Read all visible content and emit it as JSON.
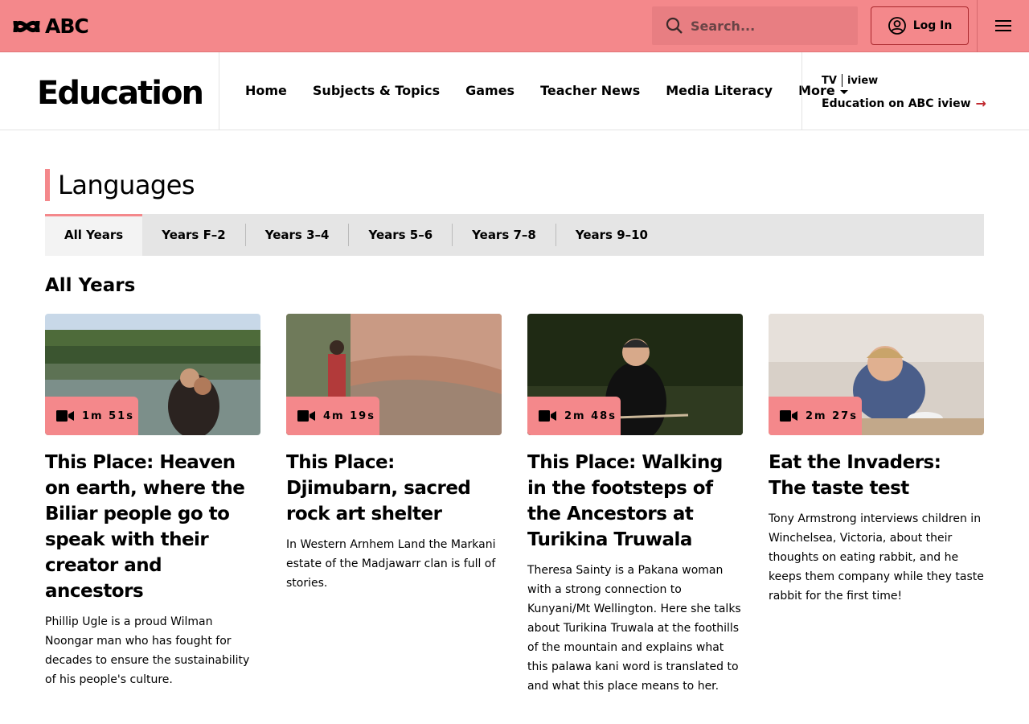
{
  "header": {
    "logo_text": "ABC",
    "search_placeholder": "Search...",
    "login_label": "Log In"
  },
  "section_nav": {
    "title": "Education",
    "links": [
      "Home",
      "Subjects & Topics",
      "Games",
      "Teacher News",
      "Media Literacy",
      "More"
    ],
    "iview": {
      "logo_tv": "TV",
      "logo_iview": "iview",
      "link_label": "Education on ABC iview"
    }
  },
  "page": {
    "heading": "Languages",
    "tabs": [
      "All Years",
      "Years F–2",
      "Years 3–4",
      "Years 5–6",
      "Years 7–8",
      "Years 9–10"
    ],
    "active_tab": "All Years",
    "subheading": "All Years"
  },
  "cards": [
    {
      "duration": "1m 51s",
      "title": "This Place: Heaven on earth, where the Biliar people go to speak with their creator and ancestors",
      "description": "Phillip Ugle is a proud Wilman Noongar man who has fought for decades to ensure the sustainability of his people's culture."
    },
    {
      "duration": "4m 19s",
      "title": "This Place: Djimubarn, sacred rock art shelter",
      "description": "In Western Arnhem Land the Markani estate of the Madjawarr clan is full of stories."
    },
    {
      "duration": "2m 48s",
      "title": "This Place: Walking in the footsteps of the Ancestors at Turikina Truwala",
      "description": "Theresa Sainty is a Pakana woman with a strong connection to Kunyani/Mt Wellington. Here she talks about Turikina Truwala at the foothills of the mountain and explains what this palawa kani word is translated to and what this place means to her."
    },
    {
      "duration": "2m 27s",
      "title": "Eat the Invaders: The taste test",
      "description": "Tony Armstrong interviews children in Winchelsea, Victoria, about their thoughts on eating rabbit, and he keeps them company while they taste rabbit for the first time!"
    }
  ],
  "colors": {
    "accent": "#f4888b",
    "link_arrow": "#c0272d"
  }
}
